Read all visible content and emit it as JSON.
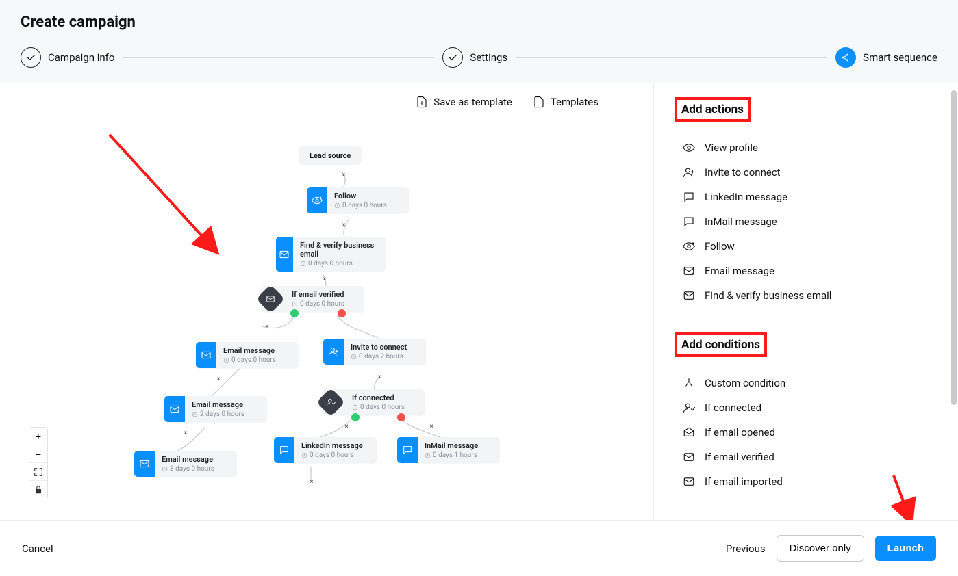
{
  "page_title": "Create campaign",
  "stepper": {
    "step1": "Campaign info",
    "step2": "Settings",
    "step3": "Smart sequence"
  },
  "toolbar": {
    "save_as_template": "Save as template",
    "templates": "Templates"
  },
  "nodes": {
    "lead_source": "Lead source",
    "follow": {
      "title": "Follow",
      "time": "0 days 0 hours"
    },
    "find_verify": {
      "title": "Find & verify business email",
      "time": "0 days 0 hours"
    },
    "if_email_verified": {
      "title": "If email verified",
      "time": "0 days 0 hours"
    },
    "email_msg_1": {
      "title": "Email message",
      "time": "0 days 0 hours"
    },
    "email_msg_2": {
      "title": "Email message",
      "time": "2 days 0 hours"
    },
    "email_msg_3": {
      "title": "Email message",
      "time": "3 days 0 hours"
    },
    "invite": {
      "title": "Invite to connect",
      "time": "0 days 2 hours"
    },
    "if_connected": {
      "title": "If connected",
      "time": "0 days 0 hours"
    },
    "linkedin_msg": {
      "title": "LinkedIn message",
      "time": "0 days 0 hours"
    },
    "inmail_msg": {
      "title": "InMail message",
      "time": "0 days 1 hours"
    }
  },
  "sidebar": {
    "actions_title": "Add actions",
    "actions": {
      "view_profile": "View profile",
      "invite_connect": "Invite to connect",
      "linkedin_message": "LinkedIn message",
      "inmail_message": "InMail message",
      "follow": "Follow",
      "email_message": "Email message",
      "find_verify": "Find & verify business email"
    },
    "conditions_title": "Add conditions",
    "conditions": {
      "custom": "Custom condition",
      "if_connected": "If connected",
      "if_email_opened": "If email opened",
      "if_email_verified": "If email verified",
      "if_email_imported": "If email imported"
    }
  },
  "footer": {
    "cancel": "Cancel",
    "previous": "Previous",
    "discover_only": "Discover only",
    "launch": "Launch"
  }
}
